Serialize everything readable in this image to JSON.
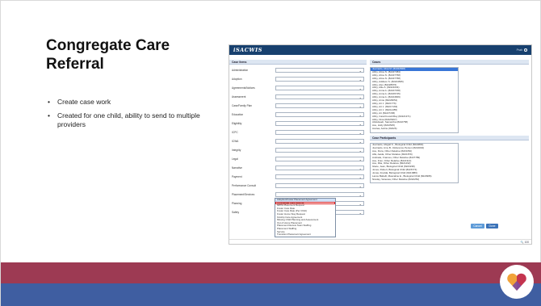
{
  "slide": {
    "title": "Congregate Care Referral",
    "bullets": [
      "Create case work",
      "Created for one child, ability to send to multiple providers"
    ]
  },
  "app": {
    "logo": "iSACWIS",
    "user": "Prah",
    "case_items_header": "Case Items",
    "cases_header": "Cases",
    "participants_header": "Case Participants",
    "form_fields": [
      "Administration",
      "Adoption",
      "Agreements/Notices",
      "Assessment",
      "Case/Family Plan",
      "Education",
      "Eligibility",
      "ICPC",
      "ICWA",
      "Integrity",
      "Legal",
      "Narrative",
      "Payment",
      "Performance Consult",
      "Placement/Services",
      "Planning",
      "Safety"
    ],
    "cases": [
      "Juarnado, Alisa M. (82222848)",
      "Abby, Alma N. (82227453)",
      "Abby, Alma N. (82227768)",
      "Abby, Alma N. (82227768)",
      "Abby, Addison S. (82224695)",
      "Abby, Alex (82228976)",
      "Abby, Allie A. (82221034)",
      "Abby, Anna A. (82227158)",
      "Abby, Anna A. (82226745)",
      "Abby, Anna A. (82224669)",
      "Abby, Arnie (82229651)",
      "Abby, Art J. (8221776)",
      "Abby, Art J. (82217163)",
      "Abby, Art J. (82211455)",
      "Abby, Art (82227158)",
      "Abby, Cass/Cousin/Ray (82221371)",
      "Abby, Nina (82225467)",
      "Abdelsaeb, Samantha (8222758)",
      "Ace, Holly (8222525)",
      "Acolea, Aubrie (82226)"
    ],
    "participants": [
      "Juarnado, Abigail K., Biological Child (8222894)",
      "Juarnado, Amy B., Reference Person (8224004)",
      "Ace, Flora, Other Relative (8223352)",
      "Alfa, Aaida, Other Relative (8221879)",
      "Andrade, Frances, Other Relative (8227789)",
      "Ace, Fran, Other Relative (8221314)",
      "Ace, Rita, Other Relative (8221492)",
      "Glace, Jean, Biological Child (8223238)",
      "Jones, Robert, Biological Child (8226774)",
      "Jonas, Fredda, Biological Child (8221886)",
      "Lance Babelli, Mascaline E., Biological Child (8223986)",
      "Nicolay, Vanessa, Other Relative (8222254)"
    ],
    "dropdown_options": [
      "Adoption/Foster Placement Agreement",
      "Congregate Care Referral",
      "MPPA Placement Request",
      "Foster Care Rate",
      "Foster Care Rate (Per Child)",
      "Foster Home Stay Request",
      "Kinship Care Agreement",
      "Missing Child Planning and Assessment",
      "Out of Home Placement",
      "Placement Review Team Staffing",
      "Placement Staffing",
      "Service",
      "Transition Placement Agreement"
    ],
    "cancel_label": "Cancel",
    "save_label": "Done",
    "footer": "🔍 100"
  }
}
